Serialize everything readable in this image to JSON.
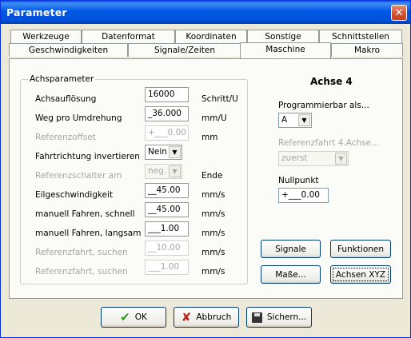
{
  "window": {
    "title": "Parameter"
  },
  "tabs_row1": [
    "Werkzeuge",
    "Datenformat",
    "Koordinaten",
    "Sonstige",
    "Schnittstellen"
  ],
  "tabs_row2": [
    "Geschwindigkeiten",
    "Signale/Zeiten",
    "Maschine",
    "Makro"
  ],
  "active_tab": "Maschine",
  "group": {
    "label": "Achsparameter"
  },
  "rows": [
    {
      "label": "Achsauflösung",
      "value": "16000",
      "unit": "Schritt/U",
      "disabled": false
    },
    {
      "label": "Weg pro Umdrehung",
      "value": "_36.000",
      "unit": "mm/U",
      "disabled": false
    },
    {
      "label": "Referenzoffset",
      "value": "+___0.00",
      "unit": "mm",
      "disabled": true
    },
    {
      "label": "Fahrtrichtung invertieren",
      "value": "Nein",
      "unit": "",
      "disabled": false
    },
    {
      "label": "Referenzschalter am",
      "value": "neg.",
      "unit": "Ende",
      "disabled": true
    },
    {
      "label": "Eilgeschwindigkeit",
      "value": "__45.00",
      "unit": "mm/s",
      "disabled": false
    },
    {
      "label": "manuell Fahren, schnell",
      "value": "__45.00",
      "unit": "mm/s",
      "disabled": false
    },
    {
      "label": "manuell Fahren, langsam",
      "value": "___1.00",
      "unit": "mm/s",
      "disabled": false
    },
    {
      "label": "Referenzfahrt, suchen",
      "value": "__10.00",
      "unit": "mm/s",
      "disabled": true
    },
    {
      "label": "Referenzfahrt, suchen",
      "value": "___1.00",
      "unit": "mm/s",
      "disabled": true
    }
  ],
  "right": {
    "heading": "Achse 4",
    "programmable_label": "Programmierbar als...",
    "programmable_value": "A",
    "ref_label": "Referenzfahrt 4.Achse...",
    "ref_value": "zuerst",
    "nullpunkt_label": "Nullpunkt",
    "nullpunkt_value": "+___0.00"
  },
  "buttons": {
    "signale": "Signale",
    "funktionen": "Funktionen",
    "masse": "Maße...",
    "achsen": "Achsen XYZ",
    "ok": "OK",
    "abbruch": "Abbruch",
    "sichern": "Sichern..."
  }
}
